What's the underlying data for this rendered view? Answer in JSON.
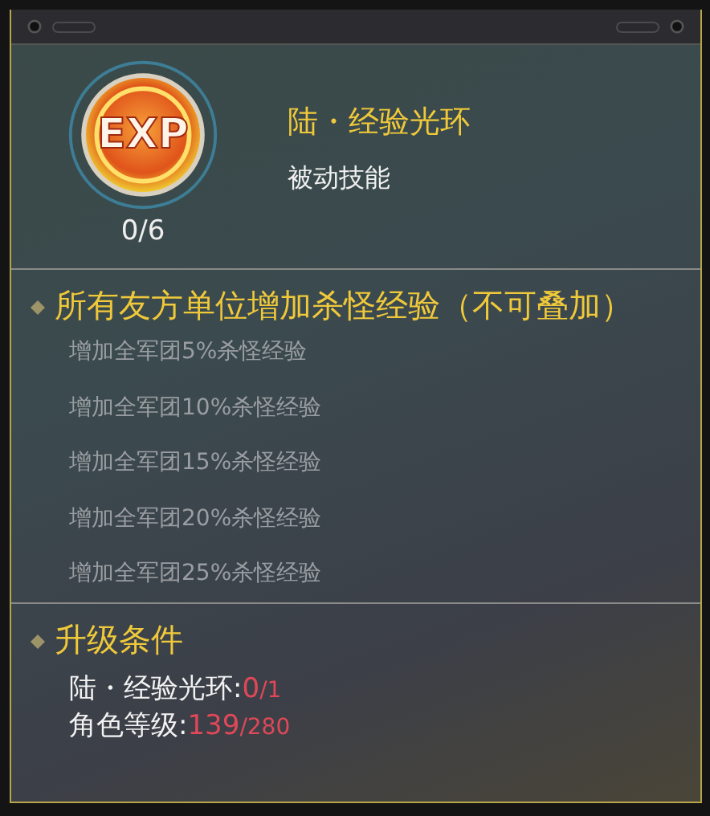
{
  "skill": {
    "badge": "EXP",
    "name": "陆・经验光环",
    "type": "被动技能",
    "progress": "0/6"
  },
  "effect": {
    "heading": "所有友方单位增加杀怪经验（不可叠加）",
    "levels": [
      {
        "text": "增加全军团5%杀怪经验"
      },
      {
        "text": "增加全军团10%杀怪经验"
      },
      {
        "text": "增加全军团15%杀怪经验"
      },
      {
        "text": "增加全军团20%杀怪经验"
      },
      {
        "text": "增加全军团25%杀怪经验"
      }
    ]
  },
  "upgrade": {
    "heading": "升级条件",
    "conditions": [
      {
        "label": "陆・经验光环:",
        "current": "0",
        "required": "/1"
      },
      {
        "label": "角色等级:",
        "current": "139",
        "required": "/280"
      }
    ]
  }
}
